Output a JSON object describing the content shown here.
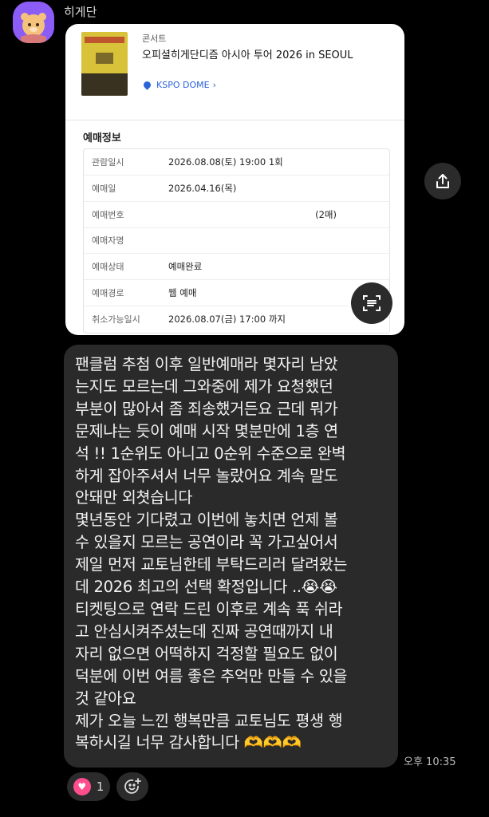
{
  "sender": {
    "name": "히게단",
    "avatar_icon": "bear-avatar-icon"
  },
  "ticket": {
    "category": "콘서트",
    "event_title": "오피셜히게단디즘 아시아 투어 2026 in SEOUL",
    "venue": "KSPO DOME",
    "venue_chevron": "›",
    "section_title": "예매정보",
    "rows": [
      {
        "label": "관람일시",
        "value": "2026.08.08(토) 19:00 1회",
        "extra": ""
      },
      {
        "label": "예매일",
        "value": "2026.04.16(목)",
        "extra": ""
      },
      {
        "label": "예매번호",
        "value": "",
        "extra": "(2매)"
      },
      {
        "label": "예매자명",
        "value": "",
        "extra": ""
      },
      {
        "label": "예매상태",
        "value": "예매완료",
        "extra": ""
      },
      {
        "label": "예매경로",
        "value": "웹 예매",
        "extra": ""
      },
      {
        "label": "취소가능일시",
        "value": "2026.08.07(금) 17:00 까지",
        "extra": ""
      }
    ]
  },
  "message": {
    "lines": [
      "팬클럼 추첨 이후 일반예매라 몇자리 남았",
      "는지도 모르는데 그와중에 제가 요청했던",
      "부분이 많아서 좀 죄송했거든요 근데 뭐가",
      "문제냐는 듯이 예매 시작 몇분만에 1층 연",
      "석 !! 1순위도 아니고 0순위 수준으로 완벽",
      "하게 잡아주셔서 너무 놀랐어요 계속 말도",
      "안돼만 외쳣습니다",
      "몇년동안 기다렸고 이번에 놓치면 언제 볼",
      "수 있을지 모르는 공연이라 꼭 가고싶어서",
      "제일 먼저 교토님한테 부탁드리러 달려왔는",
      "데 2026 최고의 선택 확정입니다 ..😭😭",
      "티켓팅으로 연락 드린 이후로 계속 푹 쉬라",
      "고 안심시켜주셨는데 진짜 공연때까지 내",
      "자리 없으면 어떡하지 걱정할 필요도 없이",
      "덕분에 이번 여름 좋은 추억만 만들 수 있을",
      "것 같아요",
      "제가 오늘 느낀 행복만큼 교토님도 평생 행",
      "복하시길 너무 감사합니다 🫶🫶🫶"
    ],
    "time": "오후 10:35"
  },
  "reactions": {
    "heart_count": "1",
    "heart_icon": "heart-icon",
    "add_icon": "add-reaction-icon"
  },
  "actions": {
    "share_icon": "share-icon",
    "scan_icon": "text-scan-icon"
  }
}
